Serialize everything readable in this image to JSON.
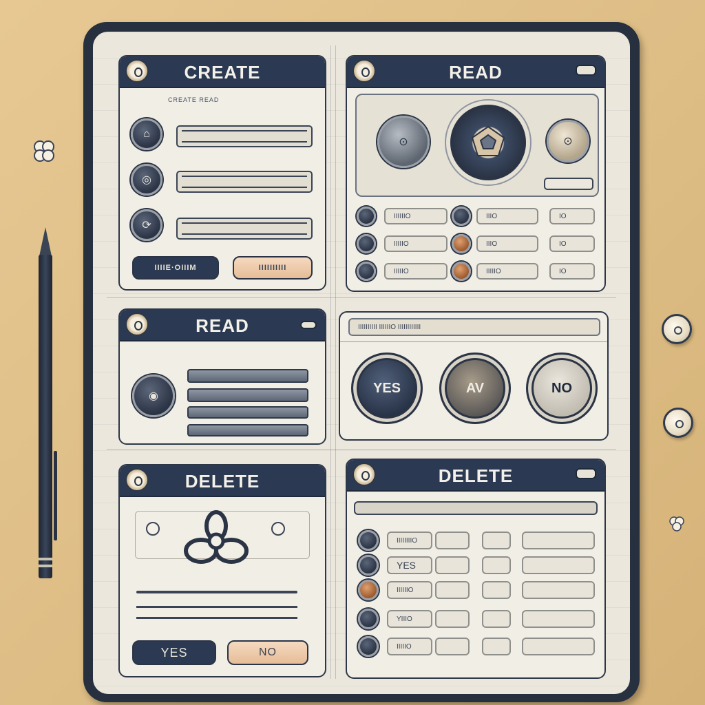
{
  "panels": {
    "create": {
      "title": "CREATE",
      "subtitle": "CREATE  READ",
      "actions": {
        "primary_label": "IIIIE·OIIIM",
        "secondary_label": "IIIIIIIIII"
      }
    },
    "read_top": {
      "title": "READ",
      "rows": [
        {
          "left": "IIIIIIO",
          "middle": "IIIO",
          "right": "IO"
        },
        {
          "left": "IIIIIO",
          "middle": "IIIO",
          "right": "IO"
        },
        {
          "left": "IIIIIO",
          "middle": "IIIIIO",
          "right": "IO"
        }
      ]
    },
    "read_left": {
      "title": "READ"
    },
    "confirm": {
      "header_label": "IIIIIIIIII  IIIIIIO  IIIIIIIIIIII",
      "yes_label": "YES",
      "av_label": "AV",
      "no_label": "NO"
    },
    "delete_left": {
      "title": "DELETE",
      "yes_label": "YES",
      "no_label": "NO"
    },
    "delete_right": {
      "title": "DELETE",
      "rows": [
        {
          "field": "IIIIIIIIO"
        },
        {
          "field": "YES"
        },
        {
          "field": "IIIIIIO"
        },
        {
          "field": "YIIIO"
        },
        {
          "field": "IIIIIO"
        }
      ]
    }
  },
  "colors": {
    "navy": "#2b3a52",
    "peach": "#e6bd98",
    "paper": "#f1eee6"
  }
}
